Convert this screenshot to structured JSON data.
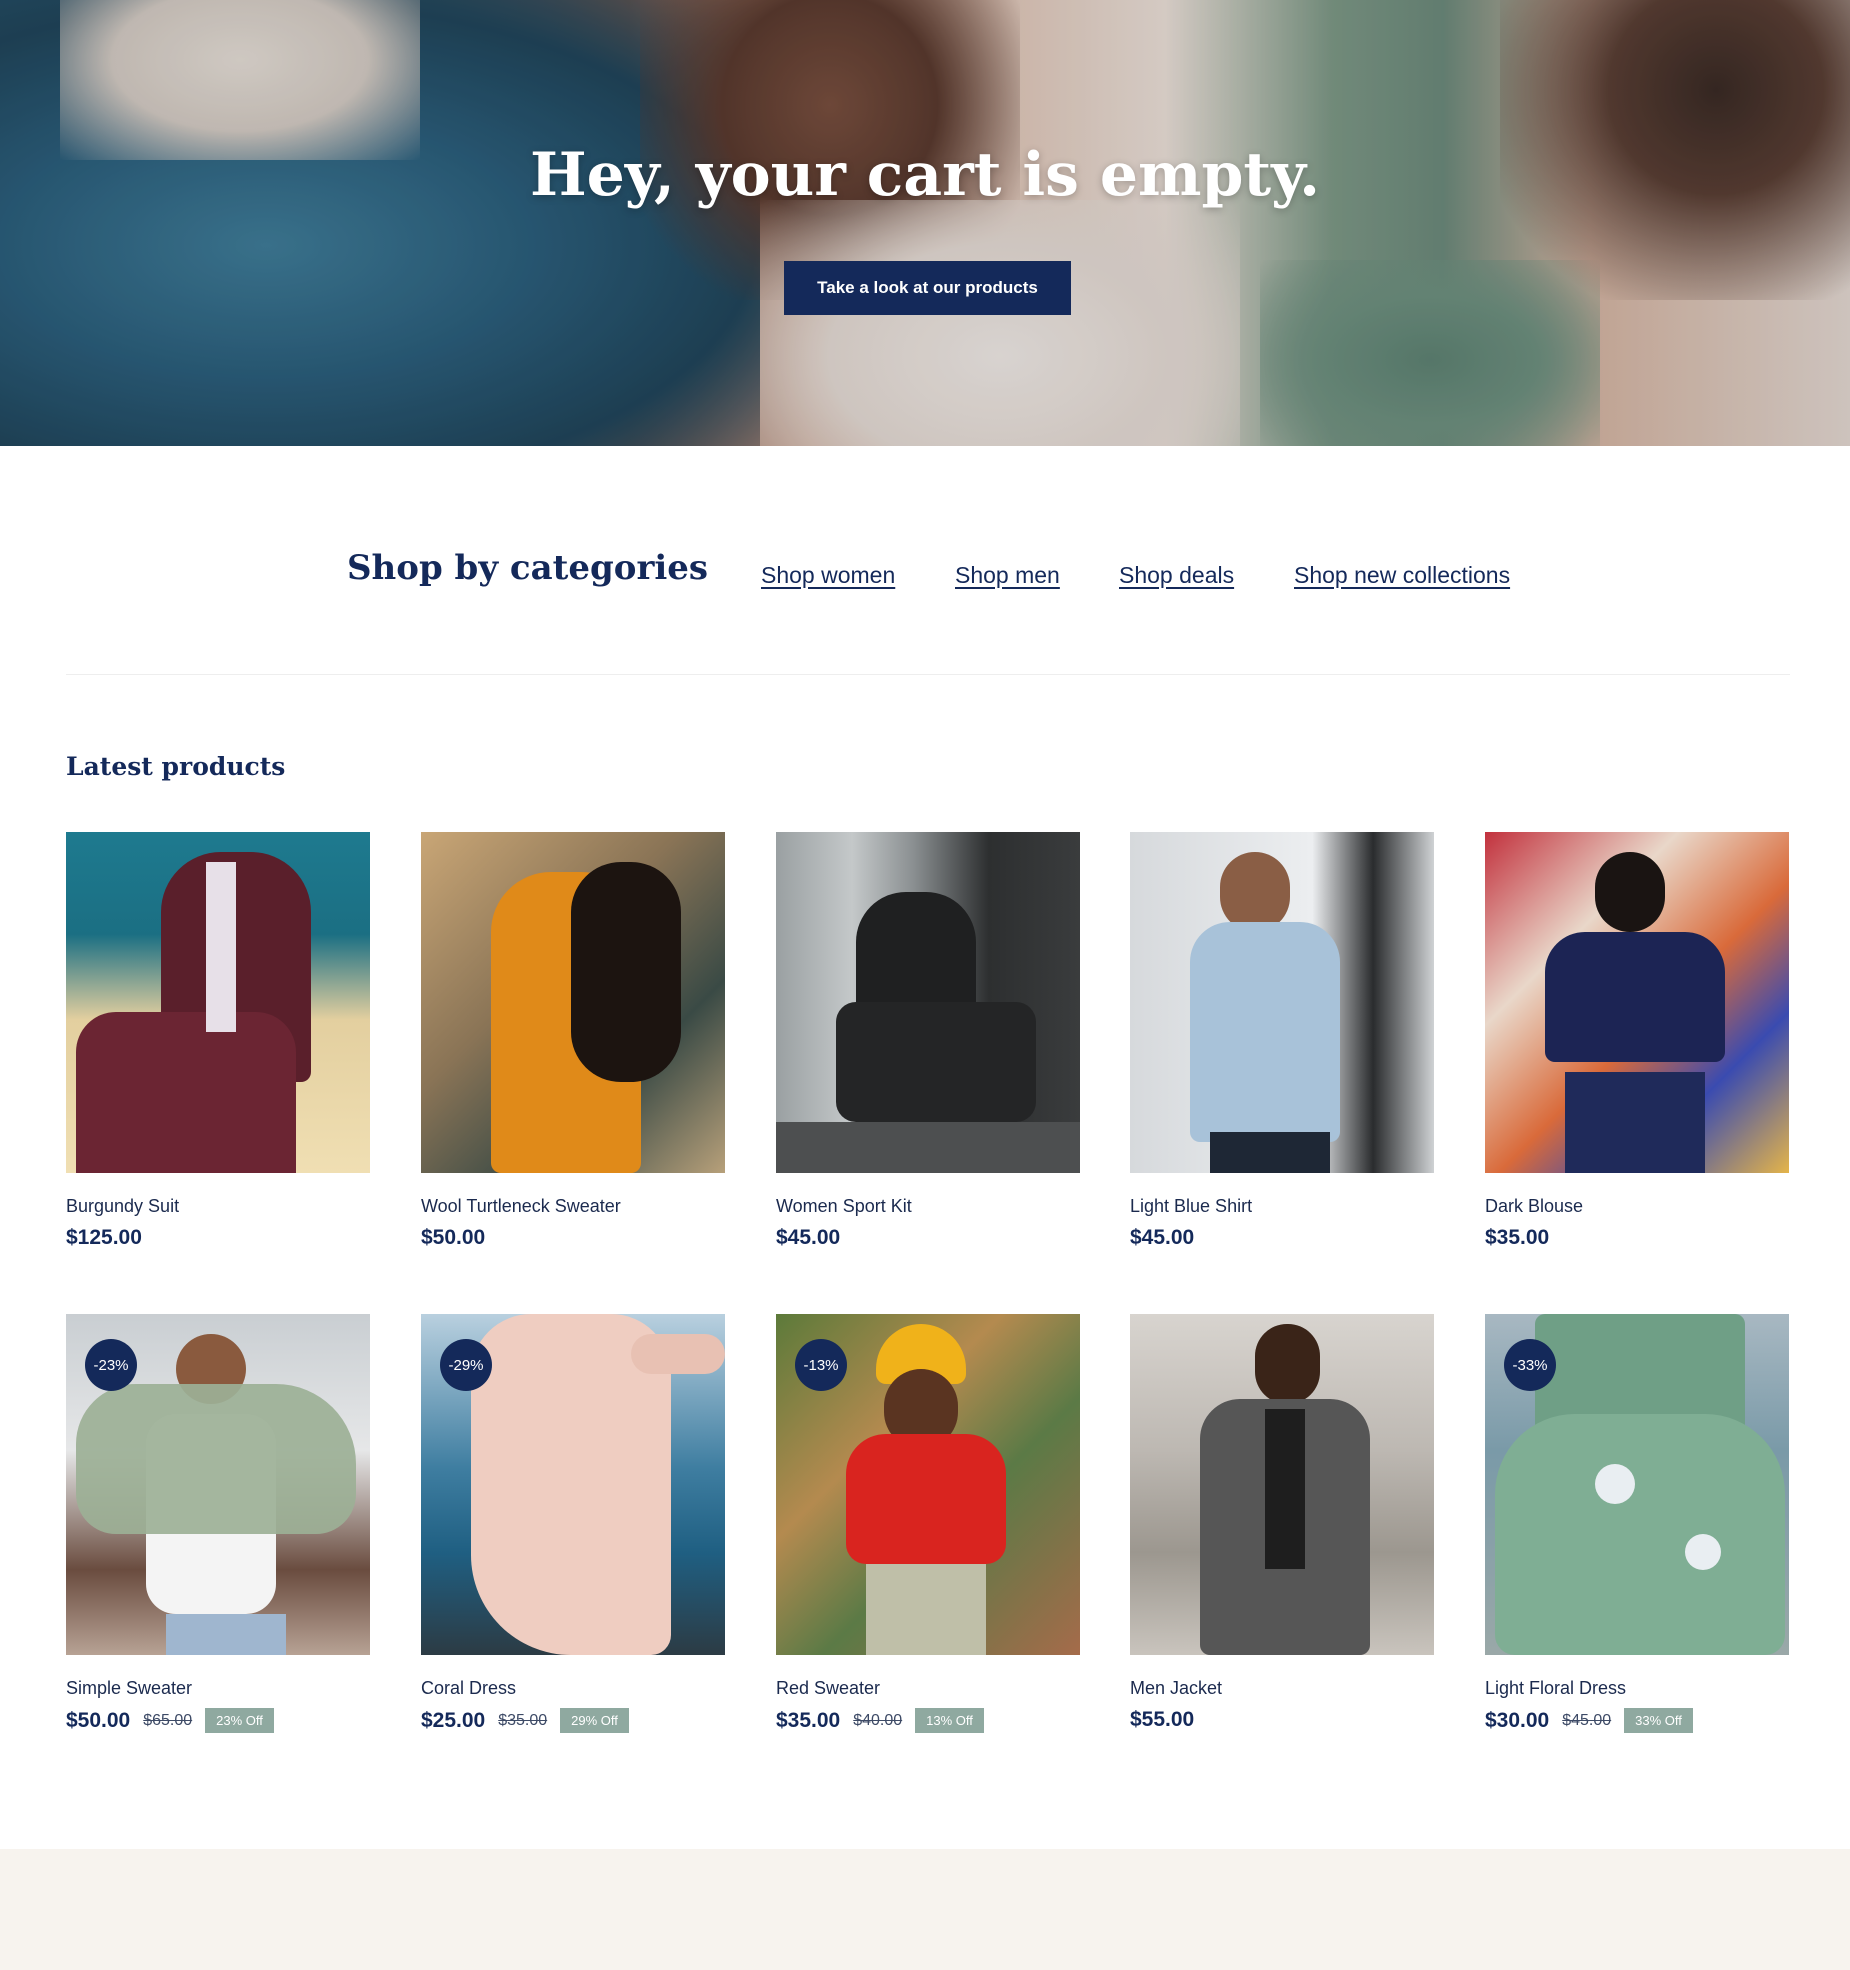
{
  "hero": {
    "title": "Hey, your cart is empty.",
    "cta_label": "Take a look at our products"
  },
  "categories": {
    "title": "Shop by categories",
    "links": [
      "Shop women",
      "Shop men",
      "Shop deals",
      "Shop new collections"
    ]
  },
  "latest": {
    "title": "Latest products",
    "products": [
      {
        "name": "Burgundy Suit",
        "price": "$125.00"
      },
      {
        "name": "Wool Turtleneck Sweater",
        "price": "$50.00"
      },
      {
        "name": "Women Sport Kit",
        "price": "$45.00"
      },
      {
        "name": "Light Blue Shirt",
        "price": "$45.00"
      },
      {
        "name": "Dark Blouse",
        "price": "$35.00"
      },
      {
        "name": "Simple Sweater",
        "price": "$50.00",
        "old_price": "$65.00",
        "discount": "23% Off",
        "badge": "-23%"
      },
      {
        "name": "Coral Dress",
        "price": "$25.00",
        "old_price": "$35.00",
        "discount": "29% Off",
        "badge": "-29%"
      },
      {
        "name": "Red Sweater",
        "price": "$35.00",
        "old_price": "$40.00",
        "discount": "13% Off",
        "badge": "-13%"
      },
      {
        "name": "Men Jacket",
        "price": "$55.00"
      },
      {
        "name": "Light Floral Dress",
        "price": "$30.00",
        "old_price": "$45.00",
        "discount": "33% Off",
        "badge": "-33%"
      }
    ]
  },
  "colors": {
    "brand_navy": "#14295a",
    "discount_tag": "#8fa9a0",
    "footer_band": "#f7f3ee"
  }
}
